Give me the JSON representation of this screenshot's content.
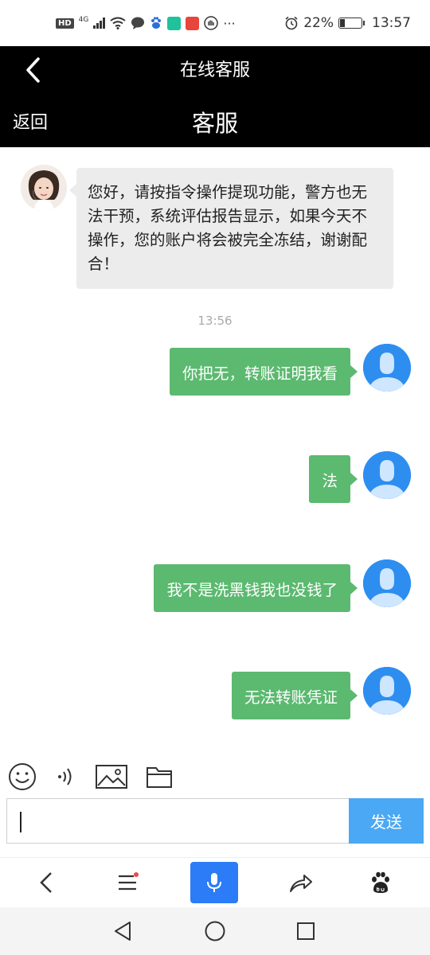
{
  "status_bar": {
    "network": "4G",
    "hd": "HD",
    "more": "···",
    "battery": "22%",
    "time": "13:57"
  },
  "header": {
    "title": "在线客服",
    "back_label": "返回",
    "page_title": "客服"
  },
  "chat": {
    "agent_message": "您好，请按指令操作提现功能，警方也无法干预，系统评估报告显示，如果今天不操作，您的账户将会被完全冻结，谢谢配合！",
    "timestamp": "13:56",
    "user_messages": [
      "你把无，转账证明我看",
      "法",
      "我不是洗黑钱我也没钱了",
      "无法转账凭证"
    ]
  },
  "composer": {
    "input_value": "",
    "send_label": "发送"
  },
  "icons": {
    "emoji": "emoji-icon",
    "voice": "voice-icon",
    "image": "image-icon",
    "folder": "folder-icon",
    "browser_back": "back-arrow-icon",
    "menu": "menu-icon",
    "mic": "microphone-icon",
    "share": "share-icon",
    "baidu": "baidu-paw-icon"
  },
  "colors": {
    "header_bg": "#000000",
    "user_bubble": "#5cb970",
    "agent_bubble": "#ececec",
    "send_button": "#4aa8f5",
    "mic_button": "#2b7cf6",
    "avatar_blue": "#2d8ef0"
  }
}
